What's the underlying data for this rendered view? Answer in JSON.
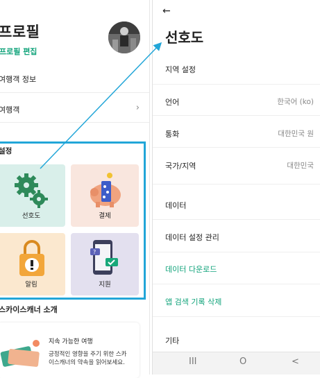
{
  "left": {
    "title": "프로필",
    "edit_link": "프로필 편집",
    "rows": [
      {
        "label": "여행객 정보"
      },
      {
        "label": "여행객"
      }
    ],
    "settings_label": "설정",
    "tiles": [
      {
        "label": "선호도",
        "color": "#d9efea"
      },
      {
        "label": "결제",
        "color": "#f9e6de"
      },
      {
        "label": "알림",
        "color": "#fbe8cf"
      },
      {
        "label": "지원",
        "color": "#e3e0ef"
      }
    ],
    "about_label": "스카이스캐너 소개",
    "card": {
      "title": "지속 가능한 여행",
      "text": "긍정적인 영향을 주기 위한 스카이스캐너의 약속을 읽어보세요."
    }
  },
  "right": {
    "back_icon": "arrow-left-icon",
    "title": "선호도",
    "rows": [
      {
        "label": "지역 설정",
        "value": ""
      },
      {
        "label": "언어",
        "value": "한국어 (ko)"
      },
      {
        "label": "통화",
        "value": "대한민국 원"
      },
      {
        "label": "국가/지역",
        "value": "대한민국"
      },
      {
        "label": "데이터",
        "value": ""
      },
      {
        "label": "데이터 설정 관리",
        "value": ""
      },
      {
        "label": "데이터 다운로드",
        "value": ""
      },
      {
        "label": "앱 검색 기록 삭제",
        "value": ""
      },
      {
        "label": "기타",
        "value": ""
      }
    ],
    "nav": {
      "recent": "III",
      "home": "O",
      "back": "<"
    }
  },
  "colors": {
    "accent": "#10a37a",
    "highlight": "#22a6d8"
  }
}
